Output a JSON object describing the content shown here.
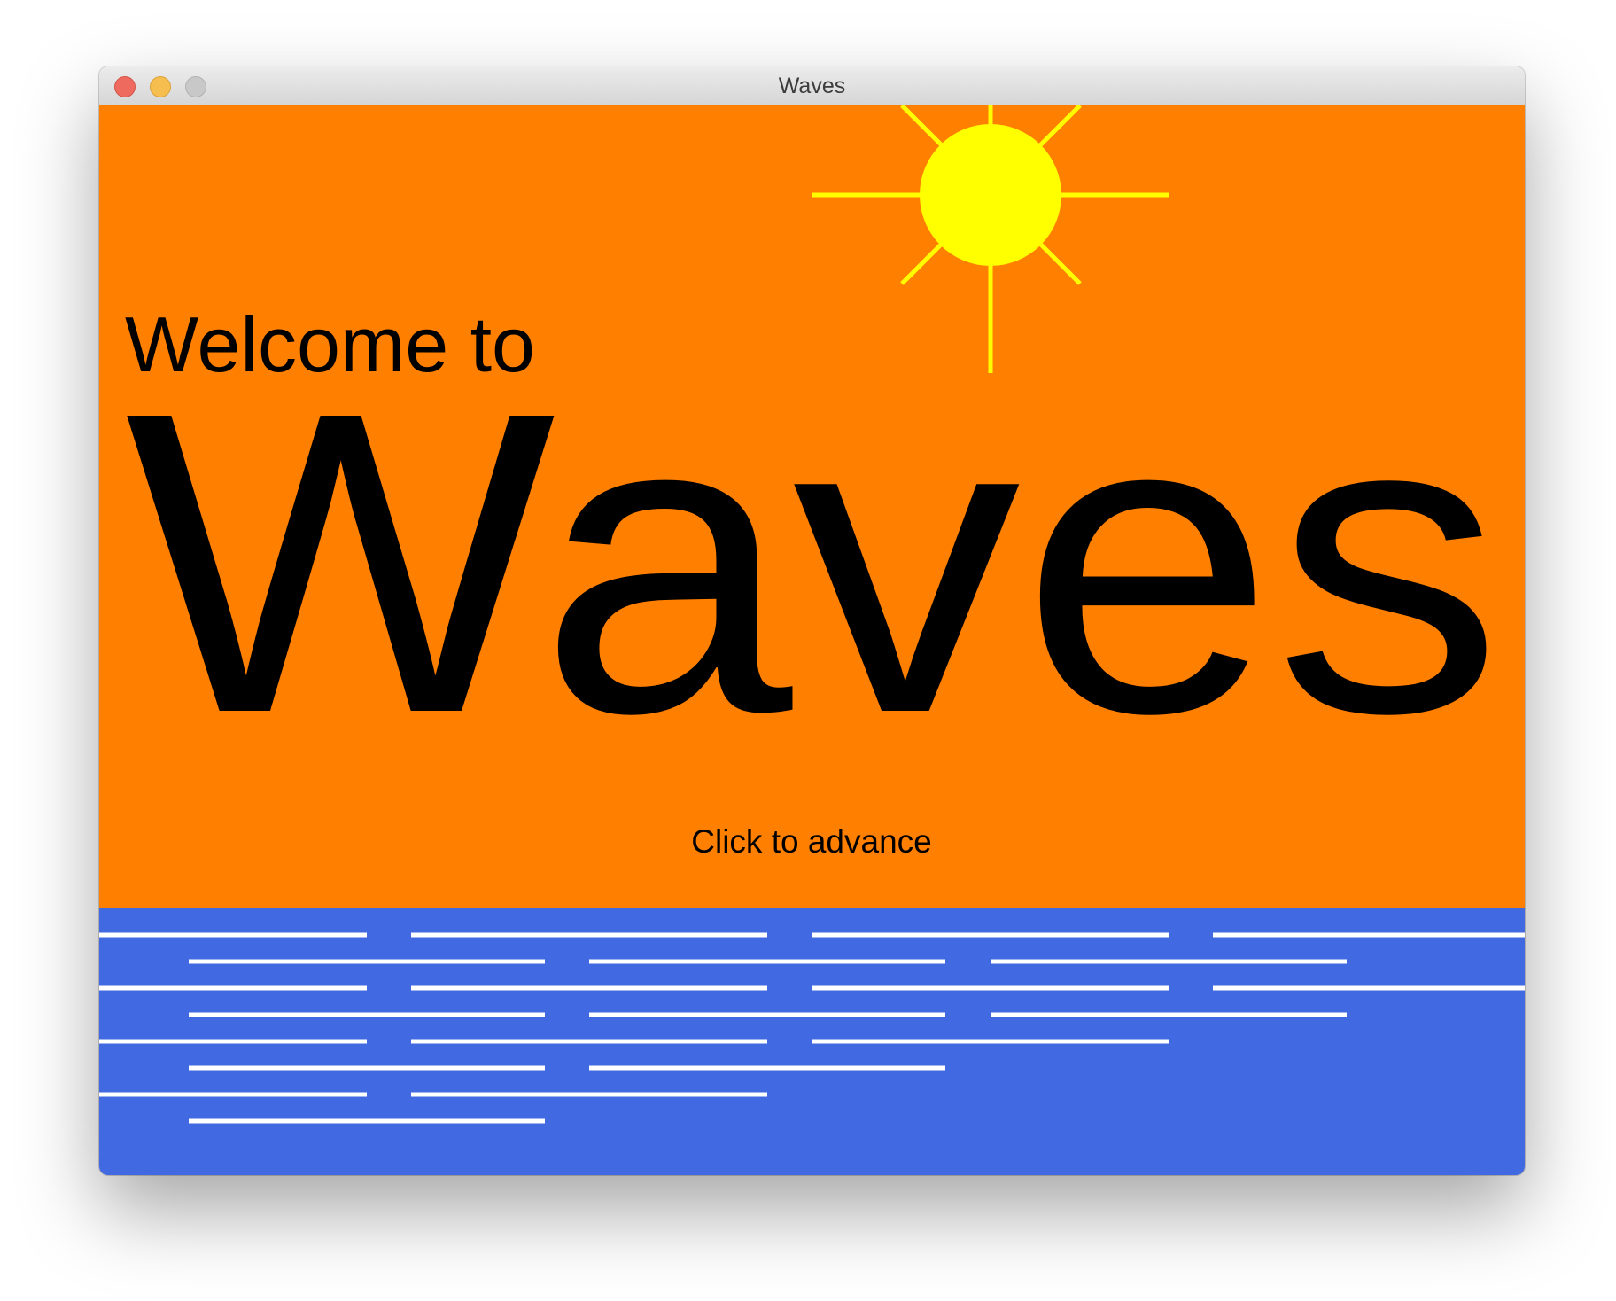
{
  "window": {
    "title": "Waves",
    "controls": {
      "close": "close-button",
      "minimize": "minimize-button",
      "zoom": "zoom-button"
    }
  },
  "scene": {
    "sky_color": "#ff7f00",
    "sea_color": "#4169e1",
    "sun_color": "#ffff00",
    "wave_color": "#ffffff",
    "welcome_text": "Welcome to",
    "title_text": "Waves",
    "prompt_text": "Click to advance"
  }
}
